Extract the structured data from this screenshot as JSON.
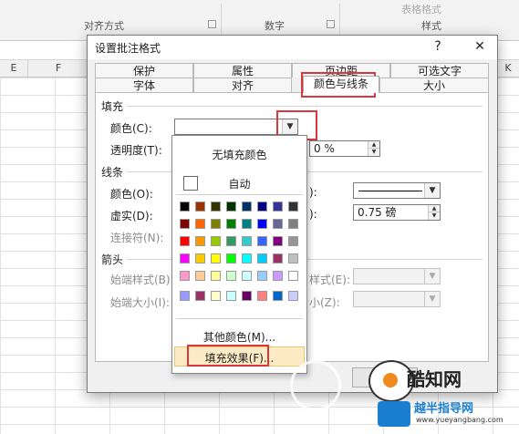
{
  "ribbon": {
    "groups": [
      "对齐方式",
      "数字",
      "样式"
    ],
    "faded": [
      "表格格式"
    ]
  },
  "sheet": {
    "columns": [
      "E",
      "F",
      "K"
    ]
  },
  "dialog": {
    "title": "设置批注格式",
    "help": "?",
    "close": "✕",
    "tabs_back": [
      "保护",
      "属性",
      "页边距",
      "可选文字"
    ],
    "tabs_front": [
      "字体",
      "对齐",
      "颜色与线条",
      "大小"
    ],
    "active_tab": "颜色与线条",
    "fill": {
      "section": "填充",
      "color_label": "颜色(C):",
      "transparency_label": "透明度(T):",
      "transparency_value": "0 %"
    },
    "line": {
      "section": "线条",
      "color_label": "颜色(O):",
      "dash_label": "虚实(D):",
      "connector_label": "连接符(N):",
      "style_suffix": "):",
      "weight_suffix": "):",
      "weight_value": "0.75 磅"
    },
    "arrows": {
      "section": "箭头",
      "begin_style_label": "始端样式(B):",
      "begin_size_label": "始端大小(I):",
      "end_style_label": "样式(E):",
      "end_size_label": "小(Z):"
    }
  },
  "color_popup": {
    "no_fill": "无填充颜色",
    "automatic": "自动",
    "more_colors": "其他颜色(M)...",
    "fill_effects": "填充效果(F)...",
    "palette_rows": [
      [
        "#000000",
        "#993300",
        "#333300",
        "#003300",
        "#003366",
        "#000080",
        "#333399",
        "#333333"
      ],
      [
        "#800000",
        "#FF6600",
        "#808000",
        "#008000",
        "#008080",
        "#0000FF",
        "#666699",
        "#808080"
      ],
      [
        "#FF0000",
        "#FF9900",
        "#99CC00",
        "#339966",
        "#33CCCC",
        "#3366FF",
        "#800080",
        "#969696"
      ],
      [
        "#FF00FF",
        "#FFCC00",
        "#FFFF00",
        "#00FF00",
        "#00FFFF",
        "#00CCFF",
        "#993366",
        "#C0C0C0"
      ],
      [
        "#FF99CC",
        "#FFCC99",
        "#FFFF99",
        "#CCFFCC",
        "#CCFFFF",
        "#99CCFF",
        "#CC99FF",
        "#FFFFFF"
      ]
    ],
    "extra_row": [
      "#9999FF",
      "#993366",
      "#FFFFCC",
      "#CCFFFF",
      "#660066",
      "#FF8080",
      "#0066CC",
      "#CCCCFF"
    ]
  },
  "watermark": {
    "brand": "酷知网",
    "site": "越半指导网",
    "url": "www.yueyangbang.com",
    "accent": "#1b7fd1",
    "orange": "#f08a1e"
  },
  "colors": {
    "highlight": "#d9363e",
    "hover": "#fcebc4"
  }
}
